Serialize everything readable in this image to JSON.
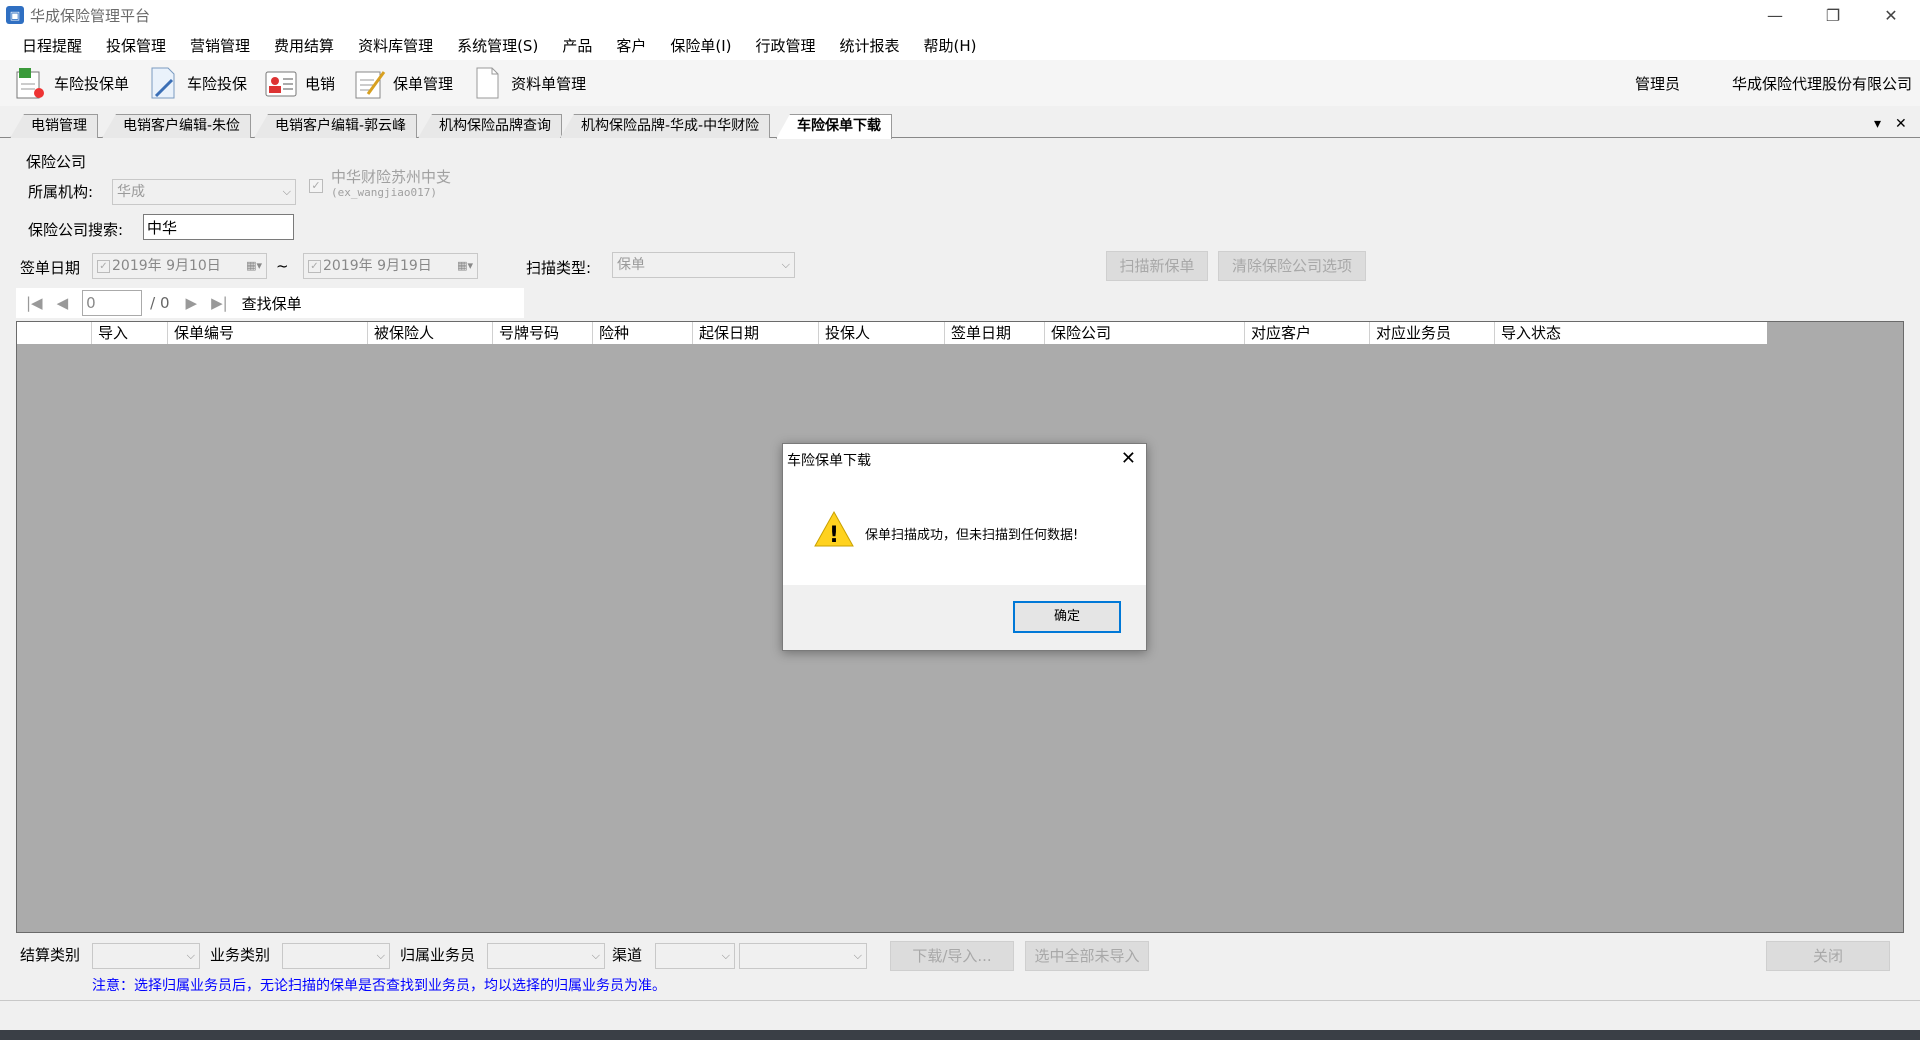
{
  "window": {
    "title": "华成保险管理平台",
    "minimize": "—",
    "restore": "❐",
    "close": "✕"
  },
  "menu": [
    "日程提醒",
    "投保管理",
    "营销管理",
    "费用结算",
    "资料库管理",
    "系统管理(S)",
    "产品",
    "客户",
    "保险单(I)",
    "行政管理",
    "统计报表",
    "帮助(H)"
  ],
  "toolbar": {
    "items": [
      {
        "label": "车险投保单",
        "icon": "car-insurance-icon"
      },
      {
        "label": "车险投保",
        "icon": "document-icon"
      },
      {
        "label": "电销",
        "icon": "contact-card-icon"
      },
      {
        "label": "保单管理",
        "icon": "edit-document-icon"
      },
      {
        "label": "资料单管理",
        "icon": "blank-document-icon"
      }
    ],
    "user": "管理员",
    "company": "华成保险代理股份有限公司"
  },
  "tabs": [
    "电销管理",
    "电销客户编辑-朱俭",
    "电销客户编辑-郭云峰",
    "机构保险品牌查询",
    "机构保险品牌-华成-中华财险",
    "车险保单下载"
  ],
  "tab_controls": {
    "dropdown": "▾",
    "close": "✕"
  },
  "form": {
    "group_label": "保险公司",
    "org_label": "所属机构:",
    "org_value": "华成",
    "branch_line1": "中华财险苏州中支",
    "branch_line2": "(ex_wangjiao017)",
    "search_label": "保险公司搜索:",
    "search_value": "中华",
    "sign_date_label": "签单日期",
    "date_from": "2019年  9月10日",
    "date_sep": "~",
    "date_to": "2019年  9月19日",
    "scan_type_label": "扫描类型:",
    "scan_type_value": "保单",
    "scan_button": "扫描新保单",
    "clear_button": "清除保险公司选项"
  },
  "nav": {
    "page_value": "0",
    "page_total": "/ 0",
    "find": "查找保单"
  },
  "grid": {
    "columns": [
      "导入",
      "保单编号",
      "被保险人",
      "号牌号码",
      "险种",
      "起保日期",
      "投保人",
      "签单日期",
      "保险公司",
      "对应客户",
      "对应业务员",
      "导入状态"
    ]
  },
  "dialog": {
    "title": "车险保单下载",
    "message": "保单扫描成功，但未扫描到任何数据!",
    "ok": "确定",
    "warning_mark": "!"
  },
  "bottom": {
    "settle_label": "结算类别",
    "biz_label": "业务类别",
    "salesman_label": "归属业务员",
    "channel_label": "渠道",
    "download_button": "下载/导入...",
    "select_button": "选中全部未导入",
    "close_button": "关闭",
    "note": "注意：选择归属业务员后，无论扫描的保单是否查找到业务员，均以选择的归属业务员为准。"
  }
}
